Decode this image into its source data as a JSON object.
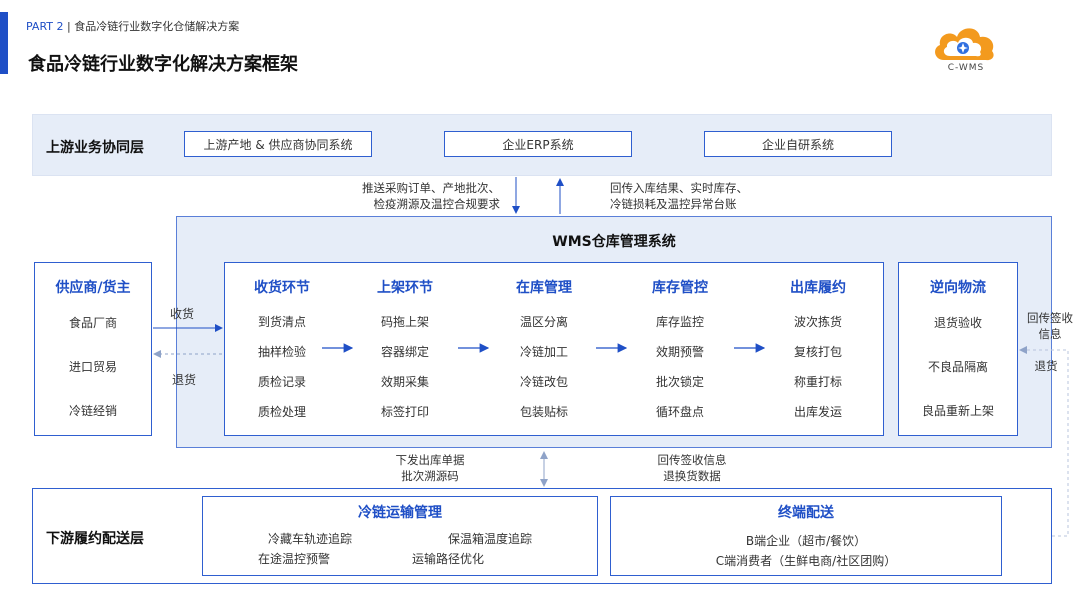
{
  "header": {
    "part": "PART 2",
    "section": "食品冷链行业数字化仓储解决方案",
    "title": "食品冷链行业数字化解决方案框架",
    "logo_text": "C-WMS"
  },
  "upstream": {
    "label": "上游业务协同层",
    "systems": [
      "上游产地 & 供应商协同系统",
      "企业ERP系统",
      "企业自研系统"
    ],
    "down_note": [
      "推送采购订单、产地批次、",
      "检疫溯源及温控合规要求"
    ],
    "up_note": [
      "回传入库结果、实时库存、",
      "冷链损耗及温控异常台账"
    ]
  },
  "supplier": {
    "title": "供应商/货主",
    "items": [
      "食品厂商",
      "进口贸易",
      "冷链经销"
    ],
    "receive_label": "收货",
    "return_label": "退货"
  },
  "wms": {
    "title": "WMS仓库管理系统",
    "stages": [
      {
        "title": "收货环节",
        "items": [
          "到货清点",
          "抽样检验",
          "质检记录",
          "质检处理"
        ]
      },
      {
        "title": "上架环节",
        "items": [
          "码拖上架",
          "容器绑定",
          "效期采集",
          "标签打印"
        ]
      },
      {
        "title": "在库管理",
        "items": [
          "温区分离",
          "冷链加工",
          "冷链改包",
          "包装贴标"
        ]
      },
      {
        "title": "库存管控",
        "items": [
          "库存监控",
          "效期预警",
          "批次锁定",
          "循环盘点"
        ]
      },
      {
        "title": "出库履约",
        "items": [
          "波次拣货",
          "复核打包",
          "称重打标",
          "出库发运"
        ]
      }
    ]
  },
  "reverse": {
    "title": "逆向物流",
    "items": [
      "退货验收",
      "不良品隔离",
      "良品重新上架"
    ],
    "side_note": [
      "回传签收",
      "信息"
    ],
    "return_label": "退货"
  },
  "mid_notes": {
    "left": [
      "下发出库单据",
      "批次溯源码"
    ],
    "right": [
      "回传签收信息",
      "退换货数据"
    ]
  },
  "downstream": {
    "label": "下游履约配送层",
    "transport": {
      "title": "冷链运输管理",
      "items": [
        "冷藏车轨迹追踪",
        "保温箱温度追踪",
        "在途温控预警",
        "运输路径优化"
      ]
    },
    "terminal": {
      "title": "终端配送",
      "items": [
        "B端企业（超市/餐饮）",
        "C端消费者（生鲜电商/社区团购）"
      ]
    }
  },
  "colors": {
    "accent": "#1f4fc6",
    "band": "#e6edf8",
    "logo_orange": "#f39a1e"
  }
}
